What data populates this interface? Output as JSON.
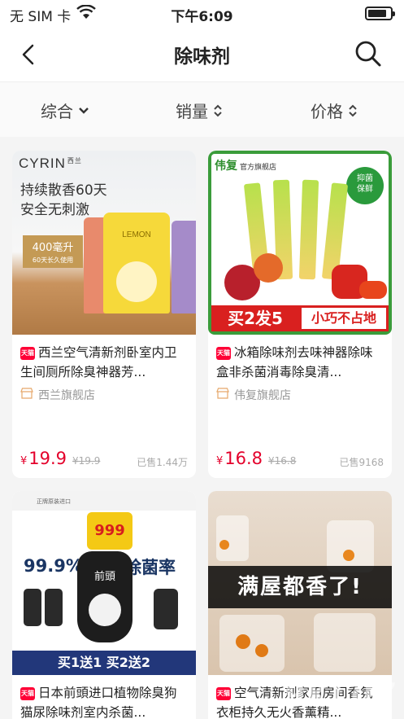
{
  "status": {
    "carrier": "无 SIM 卡",
    "time": "下午6:09"
  },
  "nav": {
    "title": "除味剂"
  },
  "sort": {
    "comprehensive": "综合",
    "sales": "销量",
    "price": "价格"
  },
  "products": [
    {
      "brand_logo": "CYRIN",
      "brand_sub": "西兰",
      "headline1": "持续散香60天",
      "headline2": "安全无刺激",
      "badge1": "400毫升",
      "badge2": "60天长久使用",
      "can_label": "LEMON",
      "tmall": "天猫",
      "name": "西兰空气清新剂卧室内卫生间厕所除臭神器芳...",
      "shop": "西兰旗舰店",
      "price": "19.9",
      "original_price": "¥19.9",
      "sold": "已售1.44万"
    },
    {
      "brand_logo": "伟复",
      "brand_sub": "官方旗舰店",
      "seal": "抑菌保鲜",
      "promo1": "买2发5",
      "promo2": "小巧不占地",
      "tmall": "天猫",
      "name": "冰箱除味剂去味神器除味盒非杀菌消毒除臭清...",
      "shop": "伟复旗舰店",
      "price": "16.8",
      "original_price": "¥16.8",
      "sold": "已售9168"
    },
    {
      "top_label": "正牌原装进口",
      "headline1": "99.9%",
      "headline2": "除菌率",
      "bottle_label": "999",
      "brand": "前頭",
      "promo": "买1送1 买2送2",
      "tmall": "天猫",
      "name": "日本前頭进口植物除臭狗猫尿除味剂室内杀菌..."
    },
    {
      "headline": "满屋都香了!",
      "tmall": "天猫",
      "name": "空气清新剂家用房间香氛衣柜持久无火香薰精..."
    }
  ],
  "watermark": "9KL07"
}
